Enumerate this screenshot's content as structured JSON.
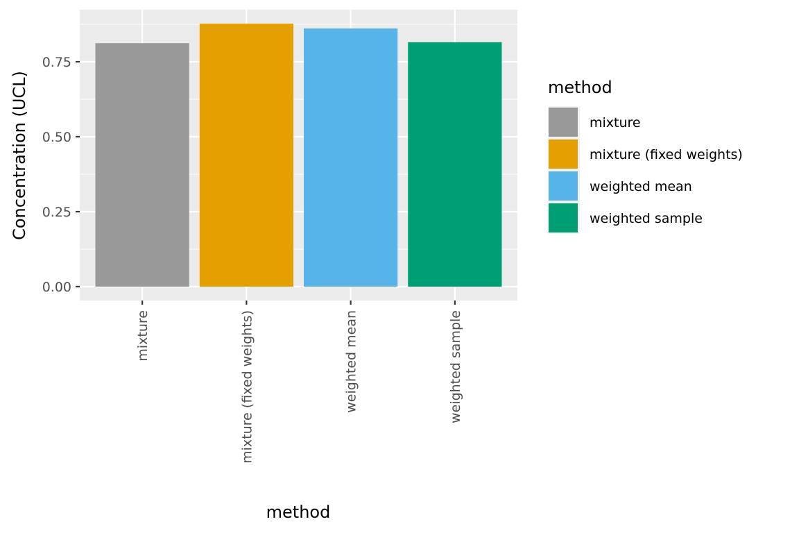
{
  "chart_data": {
    "type": "bar",
    "title": "",
    "xlabel": "method",
    "ylabel": "Concentration (UCL)",
    "categories": [
      "mixture",
      "mixture (fixed weights)",
      "weighted mean",
      "weighted sample"
    ],
    "values": [
      0.812,
      0.877,
      0.861,
      0.815
    ],
    "colors": [
      "#999999",
      "#E69F00",
      "#56B4E9",
      "#009E73"
    ],
    "ylim": [
      0,
      0.925
    ],
    "yticks": [
      0,
      0.25,
      0.5,
      0.75
    ],
    "ytick_labels": [
      "0.00",
      "0.25",
      "0.50",
      "0.75"
    ],
    "grid": true,
    "x_tick_rotation": "vertical",
    "legend": {
      "title": "method",
      "placement": "right",
      "entries": [
        "mixture",
        "mixture (fixed weights)",
        "weighted mean",
        "weighted sample"
      ]
    }
  },
  "theme": {
    "panel_background": "#EBEBEB",
    "grid_color": "#FFFFFF",
    "tick_color": "#333333"
  }
}
